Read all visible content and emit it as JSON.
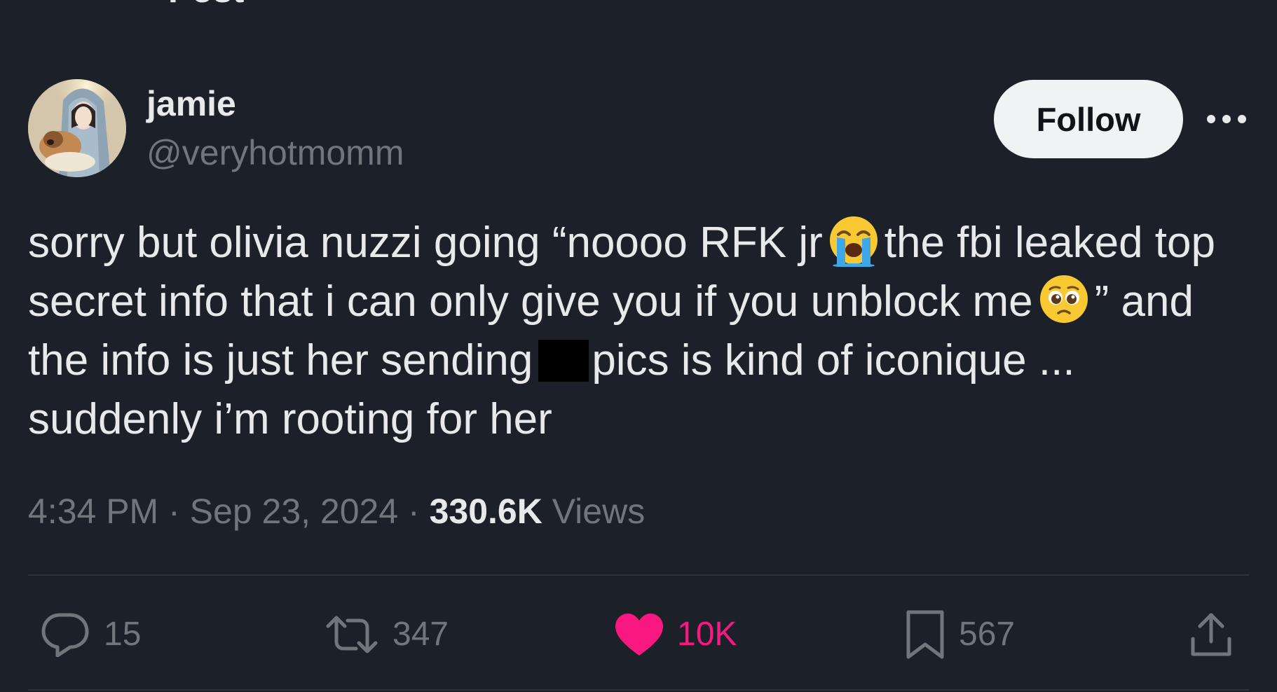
{
  "header": {
    "title": "Post"
  },
  "author": {
    "name": "jamie",
    "handle": "@veryhotmomm",
    "follow_label": "Follow"
  },
  "tweet": {
    "line1_a": "sorry but olivia nuzzi going “noooo RFK jr",
    "line1_b": "the fbi leaked top",
    "line2_a": "secret info that i can only give you if you unblock me",
    "line2_b": "” and",
    "line3_a": "the info is just her sending",
    "line3_b": "pics is kind of iconique ...",
    "line4": "suddenly i’m rooting for her",
    "emoji1": "loudly-crying-face-icon",
    "emoji2": "pleading-face-icon"
  },
  "meta": {
    "time": "4:34 PM",
    "sep1": " · ",
    "date": "Sep 23, 2024",
    "sep2": " · ",
    "views_count": "330.6K",
    "views_label": " Views"
  },
  "actions": {
    "replies": "15",
    "reposts": "347",
    "likes": "10K",
    "bookmarks": "567"
  },
  "colors": {
    "background": "#1c2028",
    "text": "#e7e9ea",
    "muted": "#71767b",
    "like": "#f91880",
    "follow_bg": "#eff3f4"
  }
}
